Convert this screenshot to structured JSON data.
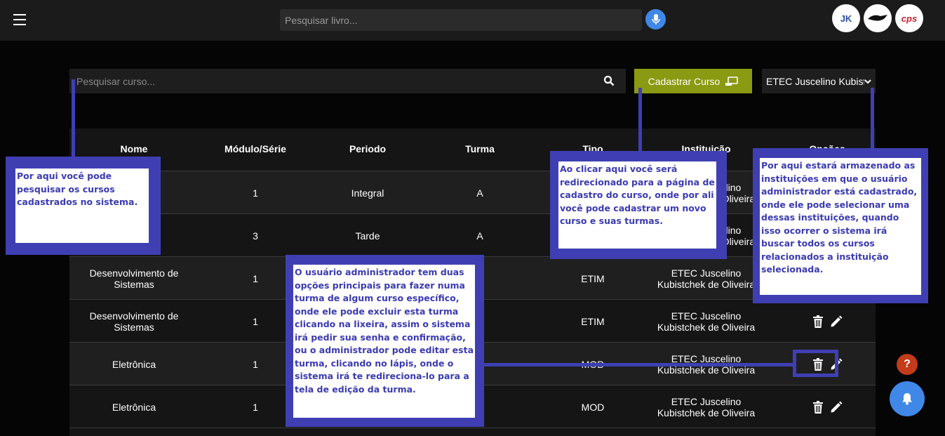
{
  "topbar": {
    "book_search_placeholder": "Pesquisar livro...",
    "logos": [
      "JK",
      "",
      "cps"
    ]
  },
  "toolbar": {
    "course_search_placeholder": "Pesquisar curso...",
    "cadastrar_label": "Cadastrar Curso",
    "institution_selected": "ETEC Juscelino Kubistchek de Oliveira"
  },
  "table": {
    "headers": [
      "Nome",
      "Módulo/Série",
      "Periodo",
      "Turma",
      "Tipo",
      "Instituição",
      "Opções"
    ],
    "rows": [
      {
        "nome": "",
        "modulo": "1",
        "periodo": "Integral",
        "turma": "A",
        "tipo": "",
        "inst": "ETEC Juscelino Kubistchek de Oliveira"
      },
      {
        "nome": "",
        "modulo": "3",
        "periodo": "Tarde",
        "turma": "A",
        "tipo": "",
        "inst": "ETEC Juscelino Kubistchek de Oliveira"
      },
      {
        "nome": "Desenvolvimento de Sistemas",
        "modulo": "1",
        "periodo": "",
        "turma": "",
        "tipo": "ETIM",
        "inst": "ETEC Juscelino Kubistchek de Oliveira"
      },
      {
        "nome": "Desenvolvimento de Sistemas",
        "modulo": "1",
        "periodo": "",
        "turma": "",
        "tipo": "ETIM",
        "inst": "ETEC Juscelino Kubistchek de Oliveira"
      },
      {
        "nome": "Eletrônica",
        "modulo": "1",
        "periodo": "",
        "turma": "",
        "tipo": "MOD",
        "inst": "ETEC Juscelino Kubistchek de Oliveira"
      },
      {
        "nome": "Eletrônica",
        "modulo": "1",
        "periodo": "",
        "turma": "",
        "tipo": "MOD",
        "inst": "ETEC Juscelino Kubistchek de Oliveira"
      }
    ]
  },
  "callouts": {
    "search": "Por aqui você pode pesquisar os cursos cadastrados no sistema.",
    "cadastrar": "Ao clicar aqui você será redirecionado para a página de cadastro do curso, onde por ali você pode cadastrar um novo curso e suas turmas.",
    "institution": "Por aqui estará armazenado as instituições em que o usuário administrador está cadastrado, onde ele pode selecionar uma dessas instituições, quando isso ocorrer o sistema irá buscar todos os cursos relacionados a instituição selecionada.",
    "options": "O usuário administrador tem duas opções principais para fazer numa turma de algum curso específico, onde ele pode excluir esta turma clicando na lixeira, assim o sistema irá pedir sua senha e confirmação, ou o administrador pode editar esta turma, clicando no lápis, onde o sistema irá te redireciona-lo para a tela de edição da turma."
  },
  "fab": {
    "help_label": "?"
  },
  "colors": {
    "accent_green": "#8a9a12",
    "callout_blue": "#3f3fb3",
    "mic_blue": "#3f88e8",
    "help_red": "#c23b1a"
  }
}
